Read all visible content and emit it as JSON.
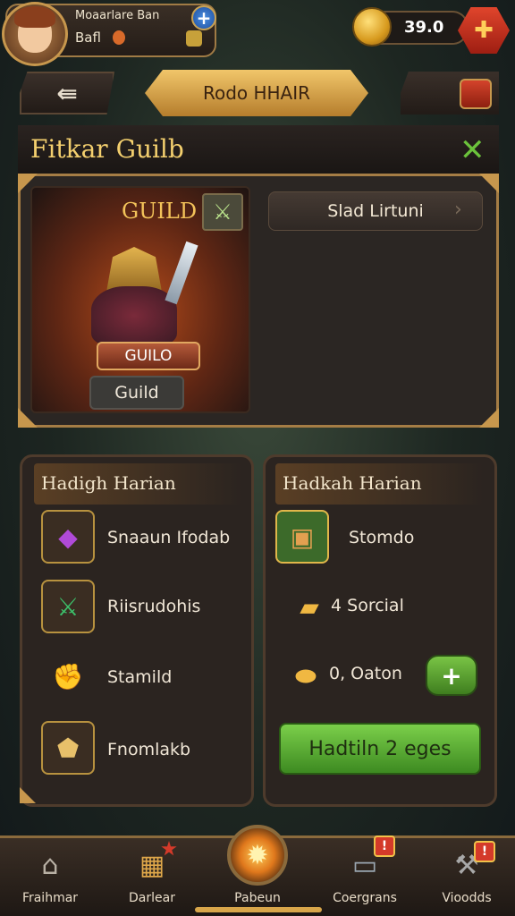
{
  "player": {
    "name": "Moaarlare Ban",
    "sub": "Bafl",
    "coins": "39.0"
  },
  "nav": {
    "title": "Rodo HHAIR"
  },
  "guild": {
    "header": "Fitkar Guilb",
    "portrait_title": "GUILD",
    "badge_red": "GUILO",
    "badge_gray": "Guild",
    "side_button": "Slad Lirtuni"
  },
  "left_panel": {
    "title": "Hadigh Harian",
    "items": [
      {
        "label": "Snaaun Ifodab",
        "icon": "purple-gem-icon"
      },
      {
        "label": "Riisrudohis",
        "icon": "green-sword-icon"
      },
      {
        "label": "Stamild",
        "icon": "gauntlet-icon"
      },
      {
        "label": "Fnomlakb",
        "icon": "gold-shield-icon"
      }
    ]
  },
  "right_panel": {
    "title": "Hadkah Harian",
    "items": [
      {
        "label": "Stomdo",
        "icon": "treasure-chest-icon"
      },
      {
        "label": "4 Sorcial",
        "icon": "gold-bar-icon"
      },
      {
        "label": "0, Oaton",
        "icon": "gold-nugget-icon"
      }
    ],
    "plus_label": "+",
    "action_label": "Hadtiln 2 eges"
  },
  "bottom_nav": [
    {
      "label": "Fraihmar",
      "icon": "house-icon"
    },
    {
      "label": "Darlear",
      "icon": "chest-icon"
    },
    {
      "label": "Pabeun",
      "icon": "fire-orb-icon"
    },
    {
      "label": "Coergrans",
      "icon": "tablet-icon"
    },
    {
      "label": "Vioodds",
      "icon": "tools-icon"
    }
  ],
  "colors": {
    "gold": "#f3cf6e",
    "accent_green": "#6bc23b",
    "frame": "#a57d45"
  }
}
